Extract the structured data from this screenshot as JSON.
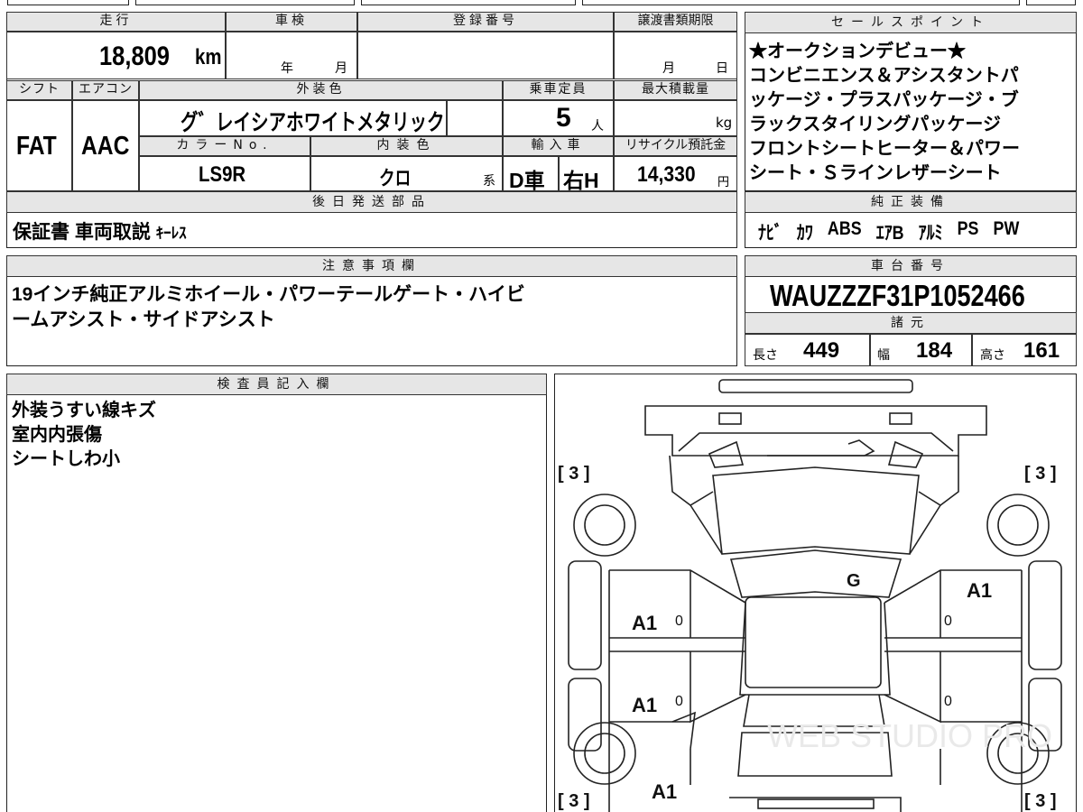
{
  "top": {
    "mileage_hdr": "走行",
    "mileage": "18,809",
    "mileage_unit": "km",
    "inspection_hdr": "車検",
    "inspection_year_unit": "年",
    "inspection_month_unit": "月",
    "reg_hdr": "登録番号",
    "transfer_hdr": "譲渡書類期限",
    "transfer_month_unit": "月",
    "transfer_day_unit": "日"
  },
  "spec": {
    "shift_hdr": "シフト",
    "shift": "FAT",
    "ac_hdr": "エアコン",
    "ac": "AAC",
    "ext_color_hdr": "外装色",
    "ext_color": "グ゛レイシアホワイトメタリック",
    "capacity_hdr": "乗車定員",
    "capacity": "5",
    "capacity_unit": "人",
    "maxload_hdr": "最大積載量",
    "maxload_unit": "kg",
    "color_no_hdr": "カラーNo.",
    "color_no": "LS9R",
    "int_color_hdr": "内装色",
    "int_color": "クロ",
    "int_color_suffix": "系",
    "import_hdr": "輸入車",
    "import_type": "D車",
    "handle": "右H",
    "recycle_hdr": "リサイクル預託金",
    "recycle": "14,330",
    "recycle_unit": "円"
  },
  "later_parts": {
    "hdr": "後日発送部品",
    "value_main": "保証書 車両取説",
    "value_small": "ｷｰﾚｽ"
  },
  "sales_points": {
    "hdr": "セールスポイント",
    "lines": [
      "★オークションデビュー★",
      "コンビニエンス＆アシスタントパ",
      "ッケージ・プラスパッケージ・ブ",
      "ラックスタイリングパッケージ",
      "フロントシートヒーター＆パワー",
      "シート・Ｓラインレザーシート"
    ]
  },
  "equipment": {
    "hdr": "純正装備",
    "items": [
      "ﾅﾋﾞ",
      "ｶﾜ",
      "ABS",
      "ｴｱB",
      "ｱﾙﾐ",
      "PS",
      "PW"
    ]
  },
  "notes": {
    "hdr": "注意事項欄",
    "lines": [
      "19インチ純正アルミホイール・パワーテールゲート・ハイビ",
      "ームアシスト・サイドアシスト"
    ]
  },
  "chassis": {
    "hdr": "車台番号",
    "value": "WAUZZZF31P1052466"
  },
  "dims": {
    "hdr": "諸元",
    "length_label": "長さ",
    "length": "449",
    "width_label": "幅",
    "width": "184",
    "height_label": "高さ",
    "height": "161"
  },
  "inspector": {
    "hdr": "検査員記入欄",
    "lines": [
      "外装うすい線キズ",
      "室内内張傷",
      "シートしわ小"
    ]
  },
  "diagram": {
    "tire_tl": "[ 3 ]",
    "tire_tr": "[ 3 ]",
    "tire_bl": "[ 3 ]",
    "tire_br": "[ 3 ]",
    "mark_g": "G",
    "mark_a1_right_front": "A1",
    "mark_a1_left_front": "A1",
    "mark_a1_left_rear": "A1",
    "mark_a1_left_bottom": "A1",
    "mark_0_1": "0",
    "mark_0_2": "0",
    "mark_0_3": "0",
    "mark_0_4": "0",
    "watermark": "WEB STUDIO PRO"
  }
}
